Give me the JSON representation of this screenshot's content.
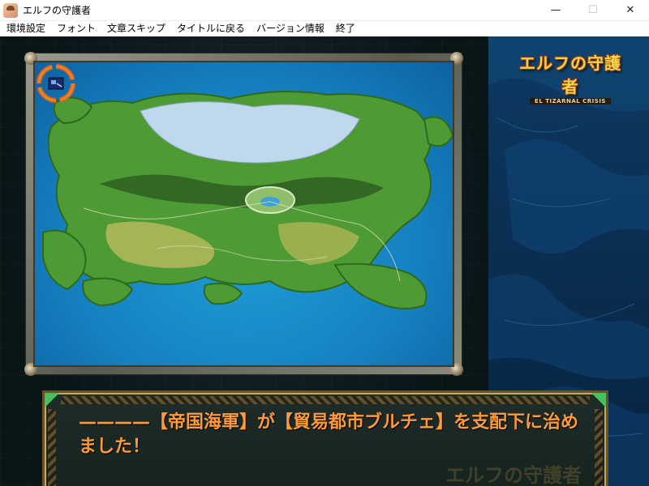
{
  "window": {
    "title": "エルフの守護者",
    "minimize_glyph": "—",
    "maximize_glyph": "☐",
    "close_glyph": "✕"
  },
  "menu": {
    "items": [
      "環境設定",
      "フォント",
      "文章スキップ",
      "タイトルに戻る",
      "バージョン情報",
      "終了"
    ]
  },
  "logo": {
    "title": "エルフの守護者",
    "subtitle": "EL TIZARNAL CRISIS"
  },
  "message": {
    "text": "————【帝国海軍】が【貿易都市ブルチェ】を支配下に治めました！",
    "watermark": "エルフの守護者"
  },
  "colors": {
    "message_text": "#ff9a3a",
    "logo_text": "#f6d34a",
    "sea": "#1a8fd0",
    "marker_orange": "#e8641e",
    "marker_gold": "#e0a030"
  },
  "icons": {
    "app": "app-icon",
    "map_marker": "city-marker-icon"
  }
}
